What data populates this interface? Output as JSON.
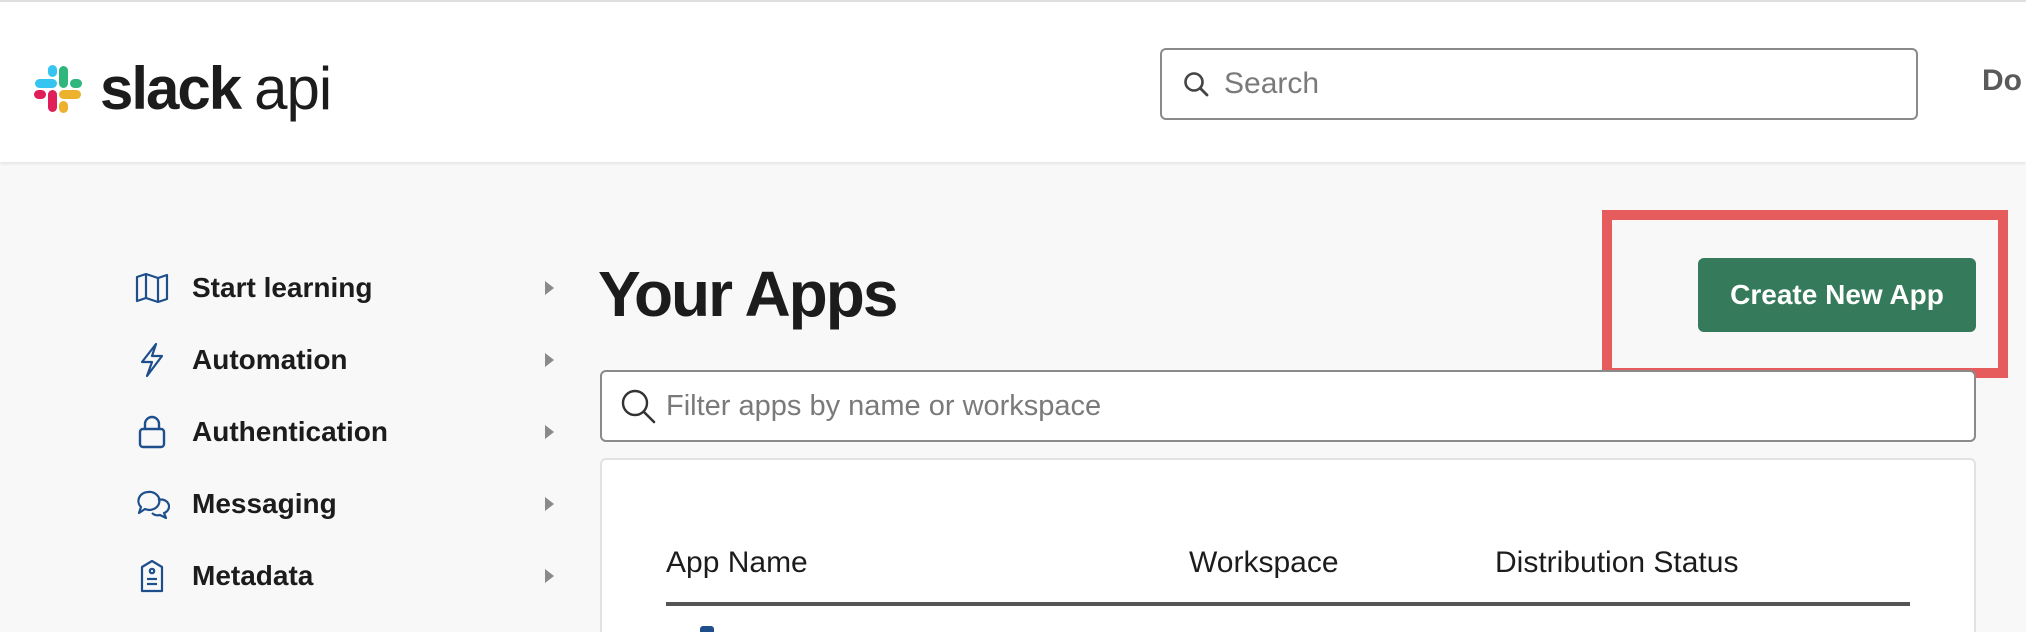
{
  "header": {
    "logo_word": "slack",
    "logo_suffix": "api",
    "search_placeholder": "Search",
    "nav_cut_label": "Do"
  },
  "sidebar": {
    "items": [
      {
        "label": "Start learning",
        "icon": "map-icon"
      },
      {
        "label": "Automation",
        "icon": "lightning-icon"
      },
      {
        "label": "Authentication",
        "icon": "lock-icon"
      },
      {
        "label": "Messaging",
        "icon": "chat-bubbles-icon"
      },
      {
        "label": "Metadata",
        "icon": "document-tag-icon"
      }
    ],
    "partial_item_icon": "grid-dots-icon"
  },
  "main": {
    "title": "Your Apps",
    "create_button": "Create New App",
    "filter_placeholder": "Filter apps by name or workspace",
    "table_headers": [
      "App Name",
      "Workspace",
      "Distribution Status"
    ]
  },
  "colors": {
    "primary_button": "#357a5b",
    "highlight_box": "#e65c5c",
    "icon_blue": "#1e4f8c",
    "slack_logo": [
      "#36c5f0",
      "#2eb67d",
      "#ecb22e",
      "#e01e5a"
    ]
  }
}
